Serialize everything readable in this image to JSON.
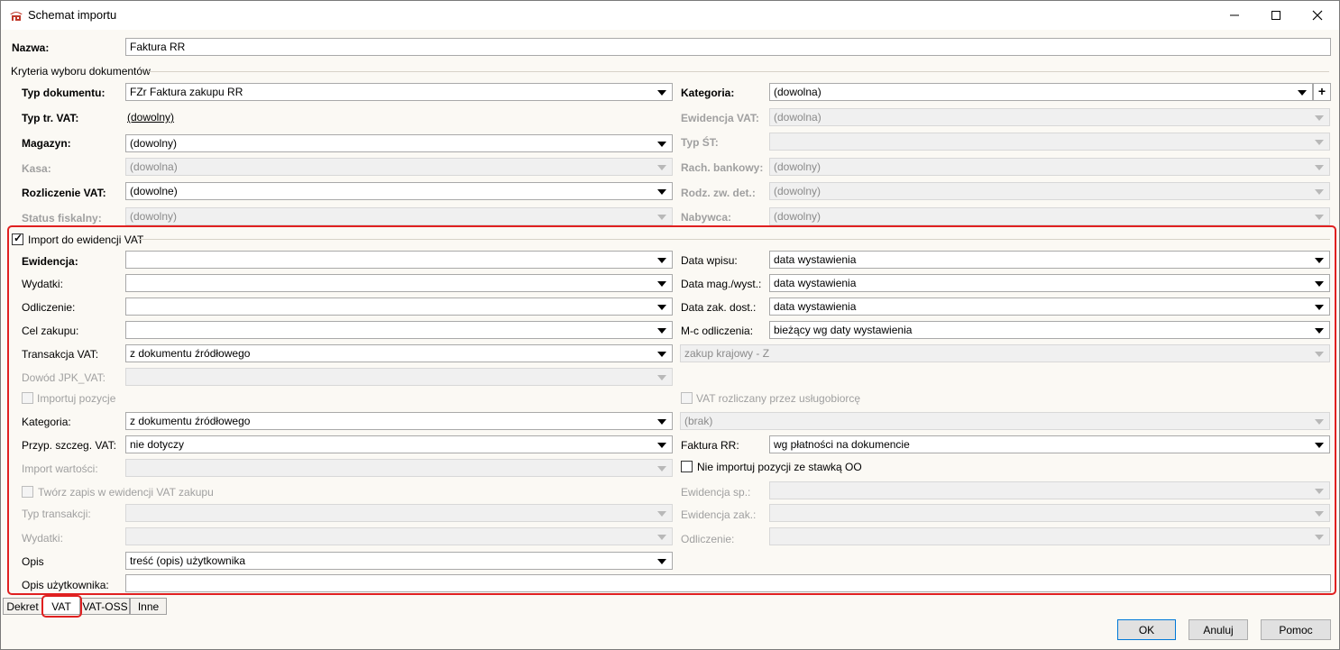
{
  "window": {
    "title": "Schemat importu"
  },
  "name": {
    "label": "Nazwa:",
    "value": "Faktura RR"
  },
  "criteria": {
    "group_title": "Kryteria wyboru dokumentów",
    "typ_dokumentu": {
      "label": "Typ dokumentu:",
      "value": "FZr Faktura zakupu RR"
    },
    "kategoria": {
      "label": "Kategoria:",
      "value": "(dowolna)",
      "add": "+"
    },
    "typ_tr_vat": {
      "label": "Typ tr. VAT:",
      "value": "(dowolny)"
    },
    "ewidencja_vat": {
      "label": "Ewidencja VAT:",
      "value": "(dowolna)"
    },
    "magazyn": {
      "label": "Magazyn:",
      "value": "(dowolny)"
    },
    "typ_st": {
      "label": "Typ ŚT:",
      "value": ""
    },
    "kasa": {
      "label": "Kasa:",
      "value": "(dowolna)"
    },
    "rach_bankowy": {
      "label": "Rach. bankowy:",
      "value": "(dowolny)"
    },
    "rozliczenie_vat": {
      "label": "Rozliczenie VAT:",
      "value": "(dowolne)"
    },
    "rodz_zw_det": {
      "label": "Rodz. zw. det.:",
      "value": "(dowolny)"
    },
    "status_fiskalny": {
      "label": "Status fiskalny:",
      "value": "(dowolny)"
    },
    "nabywca": {
      "label": "Nabywca:",
      "value": "(dowolny)"
    }
  },
  "vat": {
    "import_label": "Import do ewidencji VAT",
    "ewidencja": {
      "label": "Ewidencja:",
      "value": ""
    },
    "data_wpisu": {
      "label": "Data wpisu:",
      "value": "data wystawienia"
    },
    "wydatki": {
      "label": "Wydatki:",
      "value": ""
    },
    "data_mag": {
      "label": "Data mag./wyst.:",
      "value": "data wystawienia"
    },
    "odliczenie": {
      "label": "Odliczenie:",
      "value": ""
    },
    "data_zak": {
      "label": "Data zak. dost.:",
      "value": "data wystawienia"
    },
    "cel_zakupu": {
      "label": "Cel zakupu:",
      "value": ""
    },
    "mc_odliczenia": {
      "label": "M-c odliczenia:",
      "value": "bieżący wg daty wystawienia"
    },
    "transakcja_vat": {
      "label": "Transakcja VAT:",
      "value": "z dokumentu źródłowego"
    },
    "zakup_krajowy": {
      "value": "zakup krajowy - Z"
    },
    "dowod_jpk": {
      "label": "Dowód JPK_VAT:",
      "value": ""
    },
    "importuj_pozycje": {
      "label": "Importuj pozycje"
    },
    "vat_uslugobiorca": {
      "label": "VAT rozliczany przez usługobiorcę"
    },
    "kategoria": {
      "label": "Kategoria:",
      "value": "z dokumentu źródłowego"
    },
    "brak": {
      "value": "(brak)"
    },
    "przyp_szczeg": {
      "label": "Przyp. szczeg. VAT:",
      "value": "nie dotyczy"
    },
    "faktura_rr": {
      "label": "Faktura RR:",
      "value": "wg płatności na dokumencie"
    },
    "import_wartosci": {
      "label": "Import wartości:",
      "value": ""
    },
    "nie_importuj": {
      "label": "Nie importuj pozycji ze stawką OO"
    },
    "tworz_zapis": {
      "label": "Twórz zapis w ewidencji VAT zakupu"
    },
    "ewidencja_sp": {
      "label": "Ewidencja sp.:",
      "value": ""
    },
    "typ_transakcji": {
      "label": "Typ transakcji:",
      "value": ""
    },
    "ewidencja_zak": {
      "label": "Ewidencja zak.:",
      "value": ""
    },
    "wydatki2": {
      "label": "Wydatki:",
      "value": ""
    },
    "odliczenie2": {
      "label": "Odliczenie:",
      "value": ""
    },
    "opis": {
      "label": "Opis",
      "value": "treść (opis) użytkownika"
    },
    "opis_uzytkownika": {
      "label": "Opis użytkownika:",
      "value": ""
    }
  },
  "tabs": [
    {
      "label": "Dekret"
    },
    {
      "label": "VAT"
    },
    {
      "label": "VAT-OSS"
    },
    {
      "label": "Inne"
    }
  ],
  "buttons": {
    "ok": "OK",
    "cancel": "Anuluj",
    "help": "Pomoc"
  },
  "colors": {
    "highlight": "#e02020",
    "background": "#fbf9f4"
  }
}
